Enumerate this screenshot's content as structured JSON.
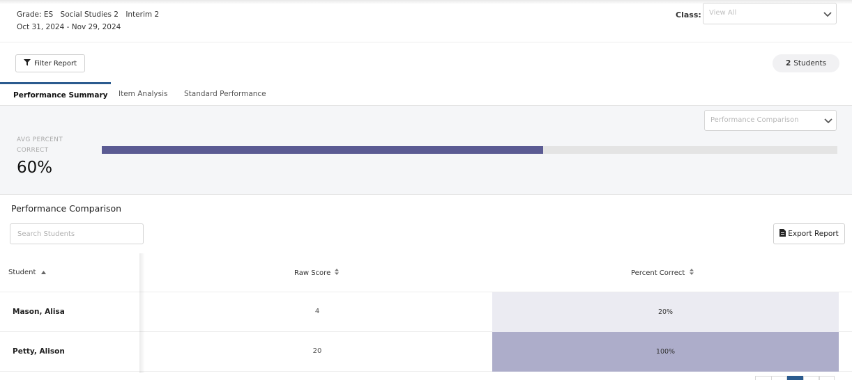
{
  "header": {
    "grade": "Grade: ES",
    "subject": "Social Studies 2",
    "assessment": "Interim 2",
    "date_range": "Oct 31, 2024 - Nov 29, 2024",
    "class_label": "Class:",
    "class_placeholder": "View All"
  },
  "toolbar": {
    "filter_label": "Filter Report",
    "student_count": "2",
    "student_count_label": "Students"
  },
  "tabs": [
    {
      "label": "Performance Summary",
      "active": true
    },
    {
      "label": "Item Analysis",
      "active": false
    },
    {
      "label": "Standard Performance",
      "active": false
    }
  ],
  "summary": {
    "comparison_select": "Performance Comparison",
    "avg_label": "AVG PERCENT CORRECT",
    "avg_value": "60%",
    "avg_percent": 60
  },
  "comparison": {
    "title": "Performance Comparison",
    "search_placeholder": "Search Students",
    "export_label": "Export Report",
    "columns": [
      "Student",
      "Raw Score",
      "Percent Correct"
    ],
    "rows": [
      {
        "student": "Mason, Alisa",
        "raw_score": "4",
        "percent": "20%"
      },
      {
        "student": "Petty, Alison",
        "raw_score": "20",
        "percent": "100%"
      }
    ]
  },
  "colors": {
    "progress_fill": "#5b5b93",
    "low_percent_cell": "#ebebf2",
    "high_percent_cell": "#adadca",
    "accent": "#2b5b8f"
  }
}
